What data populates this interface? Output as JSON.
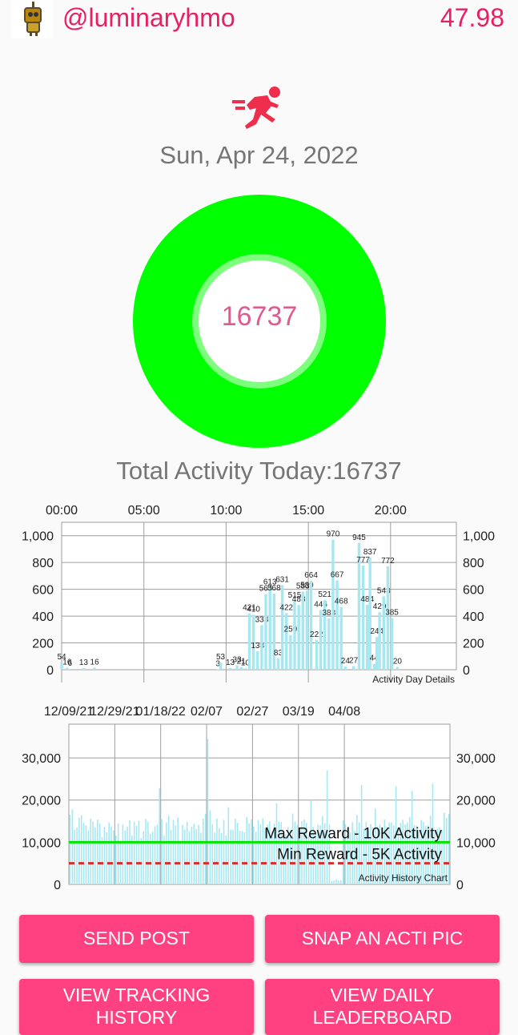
{
  "header": {
    "username": "@luminaryhmo",
    "balance": "47.98",
    "avatar_icon": "robot-avatar-icon"
  },
  "activity": {
    "icon": "running-person-icon",
    "date": "Sun, Apr 24, 2022",
    "ring_value": "16737",
    "total_label": "Total Activity Today:16737"
  },
  "colors": {
    "accent": "#e91e63",
    "button": "#ff4081",
    "ring": "#00ff00",
    "bars": "#a6e8f2",
    "max_line": "#00e600",
    "min_line": "#d32f2f"
  },
  "buttons": {
    "send_post": "SEND POST",
    "snap_pic": "SNAP AN ACTI PIC",
    "view_tracking_line1": "VIEW TRACKING",
    "view_tracking_line2": "HISTORY",
    "view_daily_line1": "VIEW DAILY",
    "view_daily_line2": "LEADERBOARD"
  },
  "chart_data": [
    {
      "type": "bar",
      "title": "Activity Day Details",
      "x_tick_labels": [
        "00:00",
        "05:00",
        "10:00",
        "15:00",
        "20:00"
      ],
      "y_ticks": [
        0,
        200,
        400,
        600,
        800,
        1000
      ],
      "y_tick_labels": [
        "0",
        "200",
        "400",
        "600",
        "800",
        "1,000"
      ],
      "ylim": [
        0,
        1100
      ],
      "x_range_minutes": [
        0,
        1440
      ],
      "bar_color": "#a6e8f2",
      "points": [
        {
          "x": 0,
          "y": 54
        },
        {
          "x": 20,
          "y": 16
        },
        {
          "x": 30,
          "y": 6
        },
        {
          "x": 80,
          "y": 13
        },
        {
          "x": 120,
          "y": 16
        },
        {
          "x": 570,
          "y": 3
        },
        {
          "x": 580,
          "y": 53
        },
        {
          "x": 615,
          "y": 13
        },
        {
          "x": 640,
          "y": 33
        },
        {
          "x": 655,
          "y": 21
        },
        {
          "x": 670,
          "y": 10
        },
        {
          "x": 685,
          "y": 421
        },
        {
          "x": 700,
          "y": 410
        },
        {
          "x": 715,
          "y": 138
        },
        {
          "x": 730,
          "y": 333
        },
        {
          "x": 745,
          "y": 564
        },
        {
          "x": 760,
          "y": 613
        },
        {
          "x": 775,
          "y": 568
        },
        {
          "x": 790,
          "y": 83
        },
        {
          "x": 805,
          "y": 631
        },
        {
          "x": 820,
          "y": 422
        },
        {
          "x": 835,
          "y": 259
        },
        {
          "x": 850,
          "y": 515
        },
        {
          "x": 865,
          "y": 483
        },
        {
          "x": 880,
          "y": 583
        },
        {
          "x": 895,
          "y": 589
        },
        {
          "x": 910,
          "y": 664
        },
        {
          "x": 930,
          "y": 222
        },
        {
          "x": 945,
          "y": 446
        },
        {
          "x": 960,
          "y": 521
        },
        {
          "x": 975,
          "y": 383
        },
        {
          "x": 990,
          "y": 970
        },
        {
          "x": 1005,
          "y": 667
        },
        {
          "x": 1020,
          "y": 468
        },
        {
          "x": 1035,
          "y": 24
        },
        {
          "x": 1065,
          "y": 27
        },
        {
          "x": 1085,
          "y": 945
        },
        {
          "x": 1100,
          "y": 777
        },
        {
          "x": 1115,
          "y": 484
        },
        {
          "x": 1125,
          "y": 837
        },
        {
          "x": 1140,
          "y": 44
        },
        {
          "x": 1150,
          "y": 244
        },
        {
          "x": 1160,
          "y": 429
        },
        {
          "x": 1175,
          "y": 548
        },
        {
          "x": 1190,
          "y": 772
        },
        {
          "x": 1205,
          "y": 385
        },
        {
          "x": 1225,
          "y": 20
        }
      ]
    },
    {
      "type": "bar",
      "title": "Activity History Chart",
      "x_tick_labels": [
        "12/09/21",
        "12/29/21",
        "01/18/22",
        "02/07",
        "02/27",
        "03/19",
        "04/08"
      ],
      "y_ticks": [
        0,
        10000,
        20000,
        30000
      ],
      "y_tick_labels": [
        "0",
        "10,000",
        "20,000",
        "30,000"
      ],
      "ylim": [
        0,
        38000
      ],
      "bar_color": "#a6e8f2",
      "max_reward": {
        "label": "Max Reward - 10K Activity",
        "value": 10000,
        "color": "#00e600"
      },
      "min_reward": {
        "label": "Min Reward - 5K Activity",
        "value": 5000,
        "color": "#d32f2f"
      },
      "values": [
        16500,
        17800,
        13000,
        13500,
        15800,
        16400,
        14600,
        14000,
        12800,
        15600,
        14900,
        13500,
        15400,
        14400,
        11200,
        13600,
        12400,
        14700,
        13800,
        12800,
        11600,
        14500,
        10200,
        14200,
        12800,
        13700,
        15200,
        11600,
        14900,
        13900,
        15100,
        11000,
        12600,
        15500,
        14800,
        12000,
        12500,
        13800,
        14200,
        22800,
        15500,
        11600,
        14700,
        16300,
        12900,
        15300,
        14000,
        15800,
        10200,
        14100,
        13000,
        14800,
        12600,
        13700,
        14400,
        13100,
        14100,
        12300,
        15600,
        16700,
        34500,
        17600,
        14300,
        12300,
        15600,
        13400,
        12200,
        15300,
        11600,
        18300,
        13000,
        13000,
        15600,
        14600,
        12700,
        12600,
        12400,
        16000,
        14500,
        15400,
        13700,
        12500,
        15300,
        14200,
        15700,
        13300,
        14200,
        15000,
        12600,
        14400,
        19300,
        14900,
        14800,
        12700,
        11900,
        13600,
        12800,
        16800,
        15000,
        14100,
        13200,
        15000,
        15400,
        14600,
        11800,
        20000,
        13600,
        12100,
        14200,
        14000,
        16200,
        14500,
        27000,
        14200,
        800,
        900,
        1200,
        900,
        1000,
        15200,
        14300,
        13600,
        12400,
        14800,
        12800,
        16500,
        14700,
        23600,
        13300,
        14800,
        12800,
        14300,
        13500,
        18000,
        13800,
        14300,
        12600,
        15400,
        13700,
        14700,
        14700,
        14000,
        23300,
        13200,
        14600,
        15300,
        14200,
        14700,
        16000,
        22200,
        14100,
        13900,
        12500,
        15300,
        14800,
        13900,
        14000,
        16300,
        23900,
        12600,
        13200,
        13500,
        12800,
        17000,
        15800,
        16737
      ]
    }
  ]
}
